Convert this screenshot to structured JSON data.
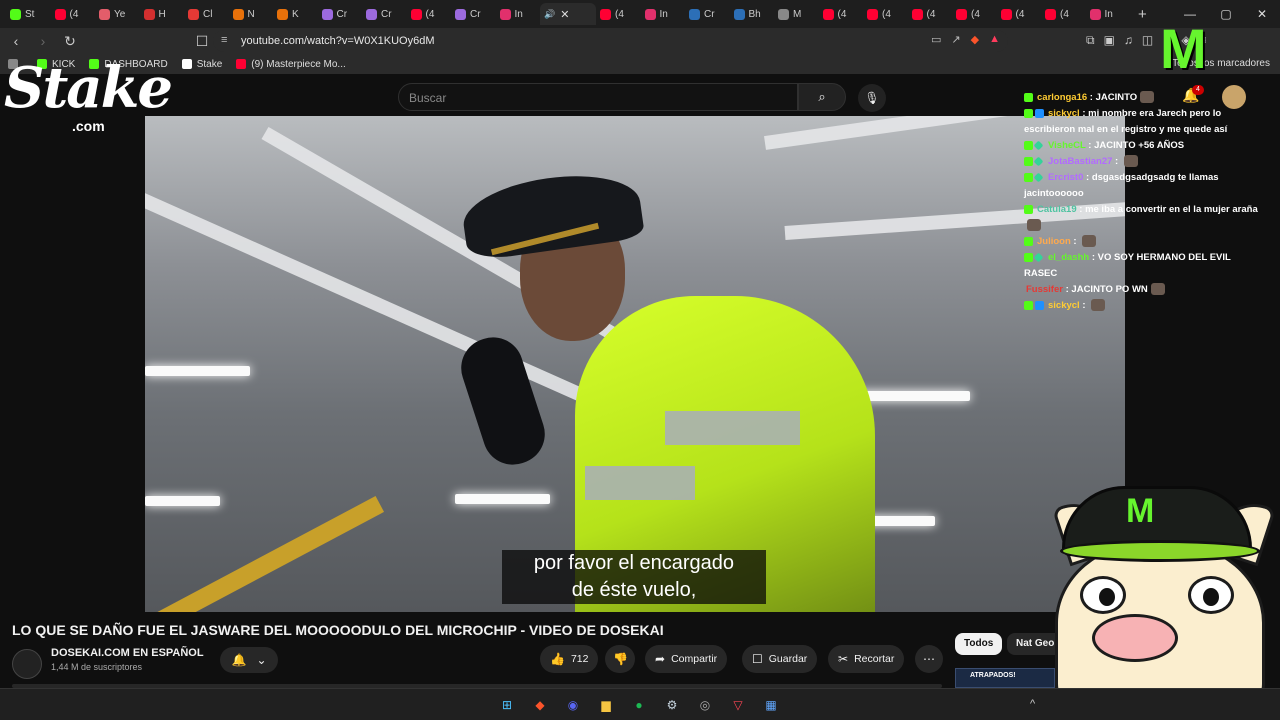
{
  "browser": {
    "tabs": [
      {
        "label": "St",
        "color": "#53fc18"
      },
      {
        "label": "(4",
        "color": "#ff0033"
      },
      {
        "label": "Ye",
        "color": "#e35d6a"
      },
      {
        "label": "H",
        "color": "#d32f2f"
      },
      {
        "label": "Cl",
        "color": "#e53935"
      },
      {
        "label": "N",
        "color": "#e8710a"
      },
      {
        "label": "K",
        "color": "#e8710a"
      },
      {
        "label": "Cr",
        "color": "#9c6ade"
      },
      {
        "label": "Cr",
        "color": "#9c6ade"
      },
      {
        "label": "(4",
        "color": "#ff0033"
      },
      {
        "label": "Cr",
        "color": "#9c6ade"
      },
      {
        "label": "In",
        "color": "#e1306c"
      }
    ],
    "active_tab": {
      "label": "",
      "close": "✕"
    },
    "tabs_after": [
      {
        "label": "(4",
        "color": "#ff0033"
      },
      {
        "label": "In",
        "color": "#e1306c"
      },
      {
        "label": "Cr",
        "color": "#2c6fb7"
      },
      {
        "label": "Bh",
        "color": "#2c6fb7"
      },
      {
        "label": "M",
        "color": "#888888"
      },
      {
        "label": "(4",
        "color": "#ff0033"
      },
      {
        "label": "(4",
        "color": "#ff0033"
      },
      {
        "label": "(4",
        "color": "#ff0033"
      },
      {
        "label": "(4",
        "color": "#ff0033"
      },
      {
        "label": "(4",
        "color": "#ff0033"
      },
      {
        "label": "(4",
        "color": "#ff0033"
      },
      {
        "label": "In",
        "color": "#e1306c"
      }
    ],
    "new_tab": "+",
    "window_controls": [
      "—",
      "▢",
      "✕"
    ],
    "url": "youtube.com/watch?v=W0X1KUOy6dM",
    "bookmarks": [
      {
        "label": "",
        "color": "#888888"
      },
      {
        "label": "KICK",
        "color": "#53fc18"
      },
      {
        "label": "DASHBOARD",
        "color": "#53fc18"
      },
      {
        "label": "Stake",
        "color": "#ffffff"
      },
      {
        "label": "(9) Masterpiece Mo...",
        "color": "#ff0033"
      }
    ],
    "bookmarks_right": "Todos los marcadores"
  },
  "youtube": {
    "search_placeholder": "Buscar",
    "search_icon": "⌕",
    "mic_icon": "🎙",
    "notification_count": "4",
    "video_title": "LO QUE SE DAÑO FUE EL JASWARE DEL MOOOOODULO DEL MICROCHIP - VIDEO DE DOSEKAI",
    "channel_name": "DOSEKAI.COM EN ESPAÑOL",
    "subscribers": "1,44 M de suscriptores",
    "like_count": "712",
    "actions": {
      "share": "Compartir",
      "save": "Guardar",
      "clip": "Recortar"
    },
    "chips": [
      "Todos",
      "Nat Geo"
    ],
    "thumbnail_text": "ATRAPADOS!",
    "subtitle_lines": [
      "por favor el encargado",
      "de éste vuelo,"
    ]
  },
  "stream_overlay": {
    "stake_logo": "Stake",
    "stake_com": ".com",
    "chat": [
      {
        "badges": [
          "kick"
        ],
        "user": "carlonga16",
        "color": "#ffcc33",
        "msg": "JACINTO",
        "emote": true
      },
      {
        "badges": [
          "kick",
          "vip"
        ],
        "user": "sickycl",
        "color": "#ffcc33",
        "msg": "mi nombre era Jarech pero lo escribieron mal en el registro y me quede así",
        "emote": false
      },
      {
        "badges": [
          "kick",
          "gem"
        ],
        "user": "VisheCL",
        "color": "#66f52e",
        "msg": "JACINTO +56 AÑOS",
        "emote": false
      },
      {
        "badges": [
          "kick",
          "gem"
        ],
        "user": "JotaBastian27",
        "color": "#b26bff",
        "msg": "",
        "emote": true
      },
      {
        "badges": [
          "kick",
          "gem"
        ],
        "user": "Ercrist0",
        "color": "#b26bff",
        "msg": "dsgasdgsadgsadg te llamas jacintoooooo",
        "emote": false
      },
      {
        "badges": [
          "kick"
        ],
        "user": "Catula19",
        "color": "#4fc3a1",
        "msg": "me iba a convertir en el la mujer araña",
        "emote": true
      },
      {
        "badges": [
          "kick"
        ],
        "user": "Julioon",
        "color": "#ffa94d",
        "msg": "",
        "emote": true
      },
      {
        "badges": [
          "kick",
          "gem"
        ],
        "user": "el_dashh",
        "color": "#66f52e",
        "msg": "VO SOY HERMANO DEL EVIL RASEC",
        "emote": false
      },
      {
        "badges": [],
        "user": "Fussifer",
        "color": "#e53935",
        "msg": "JACINTO PO WN",
        "emote": true
      },
      {
        "badges": [
          "kick",
          "vip"
        ],
        "user": "sickycl",
        "color": "#ffcc33",
        "msg": "",
        "emote": true
      }
    ],
    "mascot_logo": "M"
  },
  "taskbar": {
    "icons": [
      {
        "name": "windows-start-icon",
        "glyph": "⊞",
        "color": "#4cc2ff"
      },
      {
        "name": "brave-icon",
        "glyph": "◆",
        "color": "#fb542b"
      },
      {
        "name": "discord-icon",
        "glyph": "◉",
        "color": "#5865f2"
      },
      {
        "name": "file-explorer-icon",
        "glyph": "▆",
        "color": "#f5c542"
      },
      {
        "name": "spotify-icon",
        "glyph": "●",
        "color": "#1db954"
      },
      {
        "name": "steam-icon",
        "glyph": "⚙",
        "color": "#c7d5e0"
      },
      {
        "name": "obs-icon",
        "glyph": "◎",
        "color": "#aaaaaa"
      },
      {
        "name": "valorant-icon",
        "glyph": "▽",
        "color": "#ff4655"
      },
      {
        "name": "calculator-icon",
        "glyph": "▦",
        "color": "#60a5fa"
      }
    ],
    "tray_chevron": "^"
  }
}
